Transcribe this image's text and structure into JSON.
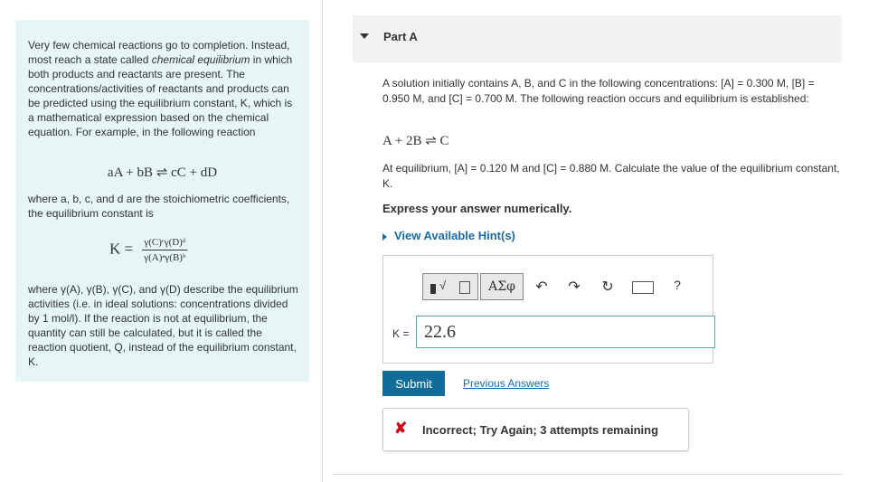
{
  "left": {
    "intro_p1": "Very few chemical reactions go to completion. Instead, most reach a state called ",
    "intro_em": "chemical equilibrium",
    "intro_p2": " in which both products and reactants are present. The concentrations/activities of reactants and products can be predicted using the equilibrium constant, K, which is a mathematical expression based on the chemical equation. For example, in the following reaction",
    "general_reaction": "aA + bB ⇌ cC + dD",
    "where_text": "where a, b, c, and d are the stoichiometric coefficients, the equilibrium constant is",
    "k_symbol": "K =",
    "k_numerator": "γ(C)ᶜγ(D)ᵈ",
    "k_denominator": "γ(A)ᵃγ(B)ᵇ",
    "where2_text": "where γ(A), γ(B), γ(C), and γ(D) describe the equilibrium activities (i.e. in ideal solutions: concentrations divided by 1 mol/l). If the reaction is not at equilibrium, the quantity can still be calculated, but it is called the reaction quotient, Q, instead of the equilibrium constant, K."
  },
  "part": {
    "title": "Part A",
    "problem": "A solution initially contains A, B, and C in the following concentrations: [A] = 0.300 M, [B] = 0.950 M, and [C] = 0.700 M. The following reaction occurs and equilibrium is established:",
    "reaction": "A + 2B ⇌ C",
    "equilibrium": "At equilibrium, [A] = 0.120 M and [C] = 0.880 M. Calculate the value of the equilibrium constant, K.",
    "express": "Express your answer numerically.",
    "hint_link": "View Available Hint(s)"
  },
  "toolbar": {
    "greek_label": "ΑΣφ",
    "undo_icon": "↶",
    "redo_icon": "↷",
    "reset_icon": "↻",
    "keyboard_icon": "⌨",
    "help_icon": "?"
  },
  "answer": {
    "label": "K =",
    "value": "22.6"
  },
  "actions": {
    "submit": "Submit",
    "previous_answers": "Previous Answers"
  },
  "feedback": {
    "icon": "✘",
    "text": "Incorrect; Try Again; 3 attempts remaining",
    "color": "#d0021b"
  }
}
